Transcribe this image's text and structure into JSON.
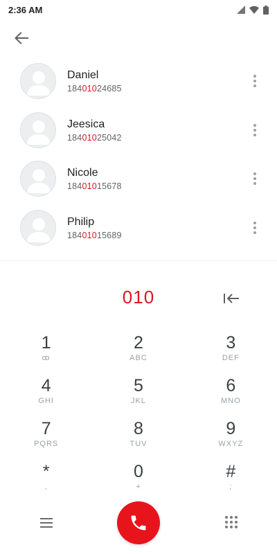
{
  "status_bar": {
    "time": "2:36 AM",
    "icons": [
      "signal-icon",
      "wifi-icon",
      "battery-icon"
    ]
  },
  "app_bar": {
    "back_icon": "arrow-back-icon"
  },
  "contacts": [
    {
      "name": "Daniel",
      "number_prefix": "184",
      "number_match": "010",
      "number_suffix": "24685"
    },
    {
      "name": "Jeesica",
      "number_prefix": "184",
      "number_match": "010",
      "number_suffix": "25042"
    },
    {
      "name": "Nicole",
      "number_prefix": "184",
      "number_match": "010",
      "number_suffix": "15678"
    },
    {
      "name": "Philip",
      "number_prefix": "184",
      "number_match": "010",
      "number_suffix": "15689"
    }
  ],
  "dialer": {
    "digits": "010",
    "backspace_icon": "backspace-icon"
  },
  "dialpad": {
    "rows": [
      [
        {
          "digit": "1",
          "letters": "ꝏ"
        },
        {
          "digit": "2",
          "letters": "ABC"
        },
        {
          "digit": "3",
          "letters": "DEF"
        }
      ],
      [
        {
          "digit": "4",
          "letters": "GHI"
        },
        {
          "digit": "5",
          "letters": "JKL"
        },
        {
          "digit": "6",
          "letters": "MNO"
        }
      ],
      [
        {
          "digit": "7",
          "letters": "PQRS"
        },
        {
          "digit": "8",
          "letters": "TUV"
        },
        {
          "digit": "9",
          "letters": "WXYZ"
        }
      ],
      [
        {
          "digit": "*",
          "letters": ","
        },
        {
          "digit": "0",
          "letters": "+"
        },
        {
          "digit": "#",
          "letters": ";"
        }
      ]
    ]
  },
  "bottom_bar": {
    "menu_icon": "menu-icon",
    "call_icon": "phone-icon",
    "keypad_icon": "dialpad-icon"
  },
  "colors": {
    "accent": "#e0141e",
    "call_button": "#e8141c"
  }
}
